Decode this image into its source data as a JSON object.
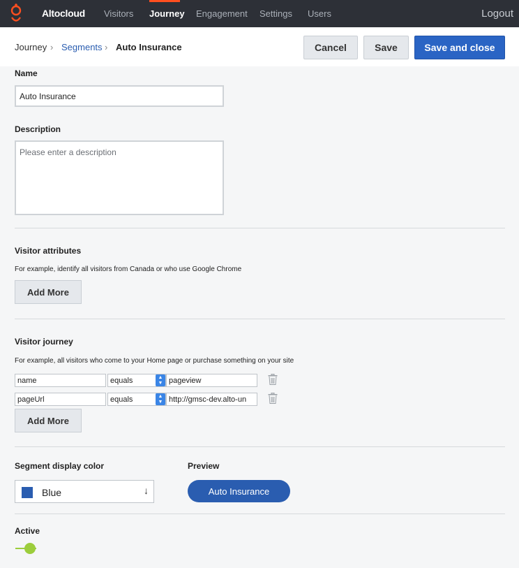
{
  "nav": {
    "brand": "Altocloud",
    "items": [
      {
        "label": "Visitors",
        "active": false
      },
      {
        "label": "Journey",
        "active": true
      },
      {
        "label": "Engagement",
        "active": false
      },
      {
        "label": "Settings",
        "active": false
      },
      {
        "label": "Users",
        "active": false
      }
    ],
    "logout": "Logout",
    "accent_color": "#ff4f1f"
  },
  "breadcrumb": {
    "items": [
      "Journey",
      "Segments",
      "Auto Insurance"
    ],
    "separator": "›"
  },
  "actions": {
    "cancel": "Cancel",
    "save": "Save",
    "save_close": "Save and close"
  },
  "form": {
    "name_label": "Name",
    "name_value": "Auto Insurance",
    "description_label": "Description",
    "description_placeholder": "Please enter a description",
    "description_value": ""
  },
  "visitor_attributes": {
    "title": "Visitor attributes",
    "hint": "For example, identify all visitors from Canada or who use Google Chrome",
    "add_more": "Add More"
  },
  "visitor_journey": {
    "title": "Visitor journey",
    "hint": "For example, all visitors who come to your Home page or purchase something on your site",
    "rows": [
      {
        "field": "name",
        "operator": "equals",
        "value": "pageview"
      },
      {
        "field": "pageUrl",
        "operator": "equals",
        "value": "http://gmsc-dev.alto-un"
      }
    ],
    "add_more": "Add More"
  },
  "display": {
    "color_label": "Segment display color",
    "color_value": "Blue",
    "color_hex": "#2a5db0",
    "preview_label": "Preview",
    "preview_pill": "Auto Insurance"
  },
  "active": {
    "label": "Active",
    "on": true,
    "color": "#9ccd3c"
  }
}
